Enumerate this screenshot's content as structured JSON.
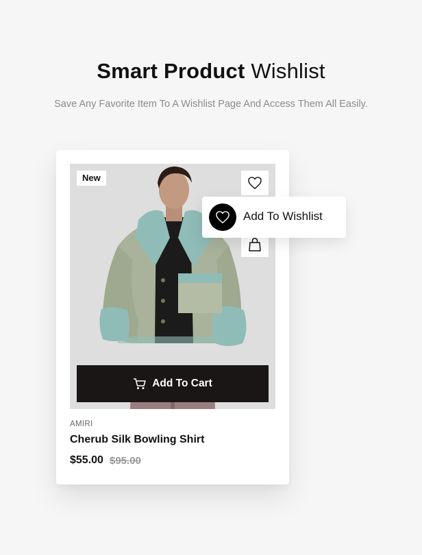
{
  "header": {
    "title_bold": "Smart Product",
    "title_light": "Wishlist",
    "subtitle": "Save Any Favorite Item To A Wishlist Page And Access Them All Easily."
  },
  "product": {
    "badge": "New",
    "brand": "AMIRI",
    "name": "Cherub Silk Bowling Shirt",
    "price": "$55.00",
    "old_price": "$95.00",
    "add_to_cart_label": "Add To Cart",
    "image_icon": "model-in-sage-shearling-jacket-photo"
  },
  "tooltip": {
    "label": "Add To Wishlist"
  },
  "icons": {
    "wishlist": "heart-icon",
    "bag": "shopping-bag-icon",
    "cart": "cart-icon"
  },
  "colors": {
    "background": "#f6f6f6",
    "card": "#ffffff",
    "button": "#1a1615",
    "old_price": "#9a9a9a",
    "subtitle": "#8b8b8b"
  }
}
